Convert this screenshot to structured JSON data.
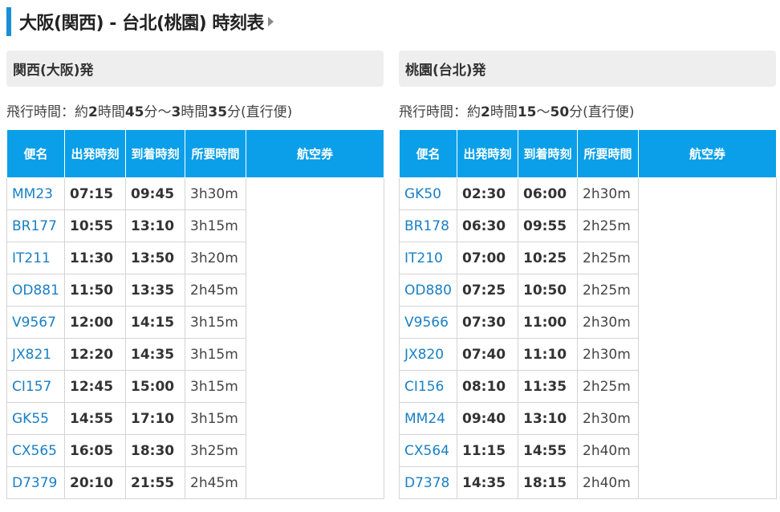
{
  "title": "大阪(関西) - 台北(桃園) 時刻表",
  "columns": [
    {
      "origin": "関西(大阪)発",
      "flight_time_text": {
        "prefix": "飛行時間：約",
        "n1": "2",
        "u1": "時間",
        "n2": "45",
        "u2": "分～",
        "n3": "3",
        "u3": "時間",
        "n4": "35",
        "u4": "分(直行便)"
      },
      "headers": {
        "flight": "便名",
        "depart": "出発時刻",
        "arrive": "到着時刻",
        "duration": "所要時間",
        "ticket": "航空券"
      },
      "rows": [
        {
          "flight": "MM23",
          "depart": "07:15",
          "arrive": "09:45",
          "duration": "3h30m"
        },
        {
          "flight": "BR177",
          "depart": "10:55",
          "arrive": "13:10",
          "duration": "3h15m"
        },
        {
          "flight": "IT211",
          "depart": "11:30",
          "arrive": "13:50",
          "duration": "3h20m"
        },
        {
          "flight": "OD881",
          "depart": "11:50",
          "arrive": "13:35",
          "duration": "2h45m"
        },
        {
          "flight": "V9567",
          "depart": "12:00",
          "arrive": "14:15",
          "duration": "3h15m"
        },
        {
          "flight": "JX821",
          "depart": "12:20",
          "arrive": "14:35",
          "duration": "3h15m"
        },
        {
          "flight": "CI157",
          "depart": "12:45",
          "arrive": "15:00",
          "duration": "3h15m"
        },
        {
          "flight": "GK55",
          "depart": "14:55",
          "arrive": "17:10",
          "duration": "3h15m"
        },
        {
          "flight": "CX565",
          "depart": "16:05",
          "arrive": "18:30",
          "duration": "3h25m"
        },
        {
          "flight": "D7379",
          "depart": "20:10",
          "arrive": "21:55",
          "duration": "2h45m"
        }
      ]
    },
    {
      "origin": "桃園(台北)発",
      "flight_time_text": {
        "prefix": "飛行時間：約",
        "n1": "2",
        "u1": "時間",
        "n2": "15",
        "u2": "～",
        "n3": "50",
        "u3": "分(直行便)",
        "n4": "",
        "u4": ""
      },
      "headers": {
        "flight": "便名",
        "depart": "出発時刻",
        "arrive": "到着時刻",
        "duration": "所要時間",
        "ticket": "航空券"
      },
      "rows": [
        {
          "flight": "GK50",
          "depart": "02:30",
          "arrive": "06:00",
          "duration": "2h30m"
        },
        {
          "flight": "BR178",
          "depart": "06:30",
          "arrive": "09:55",
          "duration": "2h25m"
        },
        {
          "flight": "IT210",
          "depart": "07:00",
          "arrive": "10:25",
          "duration": "2h25m"
        },
        {
          "flight": "OD880",
          "depart": "07:25",
          "arrive": "10:50",
          "duration": "2h25m"
        },
        {
          "flight": "V9566",
          "depart": "07:30",
          "arrive": "11:00",
          "duration": "2h30m"
        },
        {
          "flight": "JX820",
          "depart": "07:40",
          "arrive": "11:10",
          "duration": "2h30m"
        },
        {
          "flight": "CI156",
          "depart": "08:10",
          "arrive": "11:35",
          "duration": "2h25m"
        },
        {
          "flight": "MM24",
          "depart": "09:40",
          "arrive": "13:10",
          "duration": "2h30m"
        },
        {
          "flight": "CX564",
          "depart": "11:15",
          "arrive": "14:55",
          "duration": "2h40m"
        },
        {
          "flight": "D7378",
          "depart": "14:35",
          "arrive": "18:15",
          "duration": "2h40m"
        }
      ]
    }
  ]
}
